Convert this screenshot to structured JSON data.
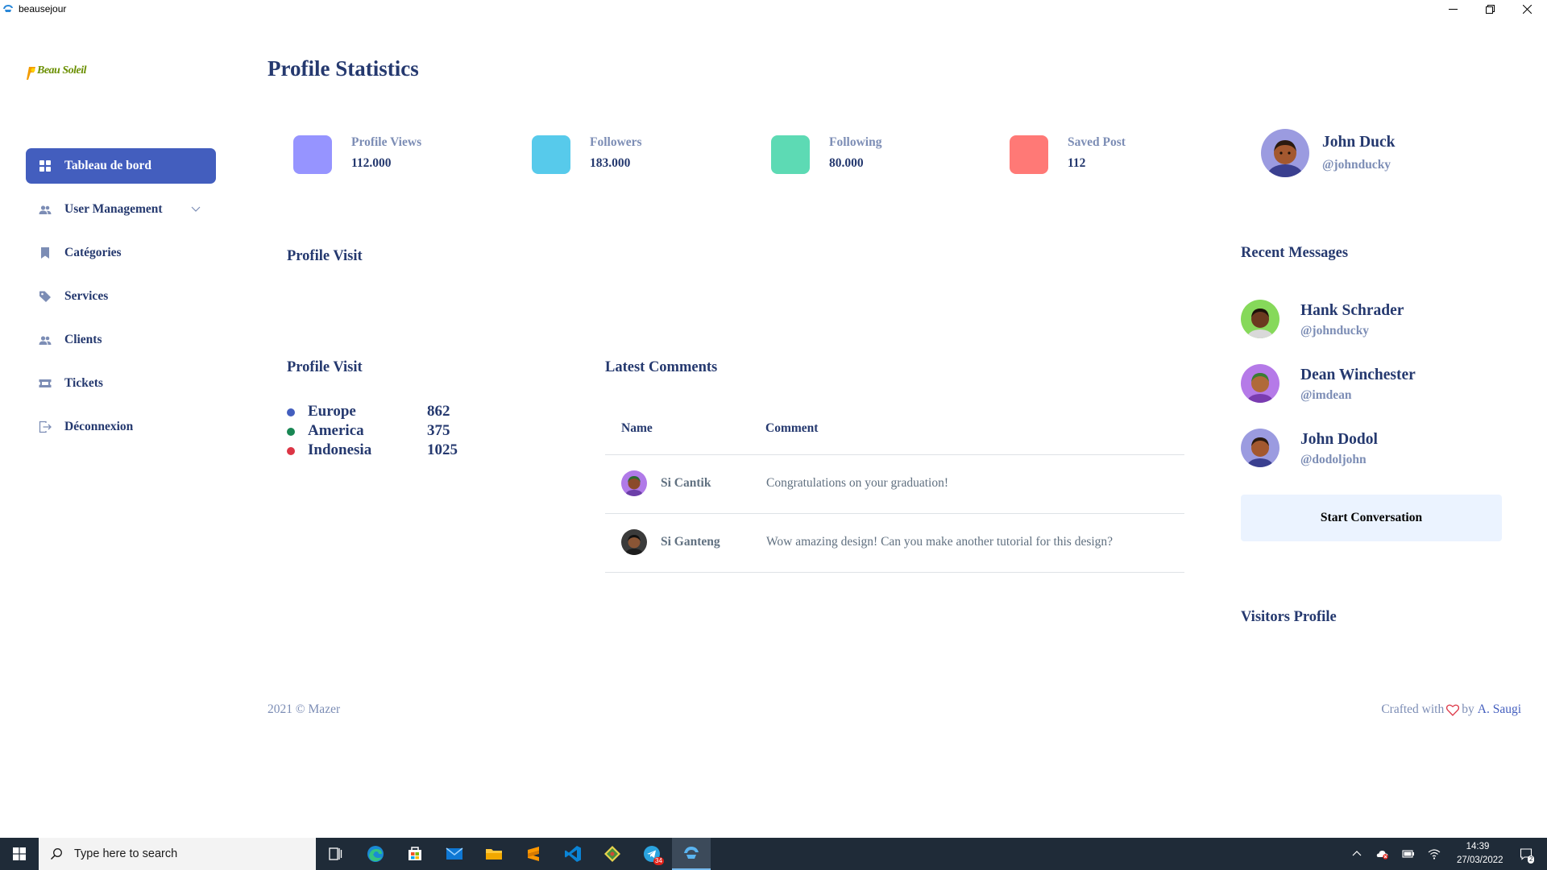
{
  "window": {
    "title": "beausejour"
  },
  "sidebar": {
    "logo_text": "Beau Soleil",
    "items": [
      {
        "label": "Tableau de bord",
        "icon": "grid-icon",
        "active": true
      },
      {
        "label": "User Management",
        "icon": "users-icon",
        "has_submenu": true
      },
      {
        "label": "Catégories",
        "icon": "bookmark-icon"
      },
      {
        "label": "Services",
        "icon": "tag-icon"
      },
      {
        "label": "Clients",
        "icon": "users-icon"
      },
      {
        "label": "Tickets",
        "icon": "ticket-icon"
      },
      {
        "label": "Déconnexion",
        "icon": "logout-icon"
      }
    ]
  },
  "page": {
    "title": "Profile Statistics"
  },
  "stats": [
    {
      "label": "Profile Views",
      "value": "112.000",
      "color": "#9694ff"
    },
    {
      "label": "Followers",
      "value": "183.000",
      "color": "#57caeb"
    },
    {
      "label": "Following",
      "value": "80.000",
      "color": "#5ddab4"
    },
    {
      "label": "Saved Post",
      "value": "112",
      "color": "#ff7976"
    }
  ],
  "profile": {
    "name": "John Duck",
    "handle": "@johnducky"
  },
  "sections": {
    "profile_visit_chart": "Profile Visit",
    "profile_visit_list": "Profile Visit",
    "latest_comments": "Latest Comments",
    "recent_messages": "Recent Messages",
    "visitors_profile": "Visitors Profile"
  },
  "visits": [
    {
      "country": "Europe",
      "count": "862",
      "color": "#435ebe"
    },
    {
      "country": "America",
      "count": "375",
      "color": "#198754"
    },
    {
      "country": "Indonesia",
      "count": "1025",
      "color": "#dc3545"
    }
  ],
  "comments": {
    "headers": {
      "name": "Name",
      "comment": "Comment"
    },
    "rows": [
      {
        "name": "Si Cantik",
        "comment": "Congratulations on your graduation!"
      },
      {
        "name": "Si Ganteng",
        "comment": "Wow amazing design! Can you make another tutorial for this design?"
      }
    ]
  },
  "messages": [
    {
      "name": "Hank Schrader",
      "handle": "@johnducky"
    },
    {
      "name": "Dean Winchester",
      "handle": "@imdean"
    },
    {
      "name": "John Dodol",
      "handle": "@dodoljohn"
    }
  ],
  "start_conversation": "Start Conversation",
  "footer": {
    "left": "2021 © Mazer",
    "crafted": "Crafted with",
    "by": "by",
    "author": "A. Saugi"
  },
  "taskbar": {
    "search_placeholder": "Type here to search",
    "time": "14:39",
    "date": "27/03/2022",
    "telegram_badge": "34",
    "notifications": "2"
  }
}
